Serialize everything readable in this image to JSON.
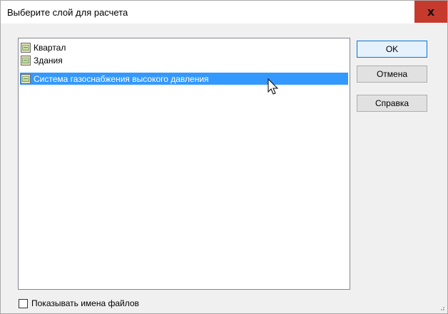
{
  "dialog": {
    "title": "Выберите слой для расчета",
    "close_symbol": "x"
  },
  "layers": [
    {
      "label": "Квартал",
      "icon": "layer-icon",
      "selected": false
    },
    {
      "label": "Здания",
      "icon": "layer-icon",
      "selected": false
    },
    {
      "label": "Система газоснабжения высокого давления",
      "icon": "layer-icon",
      "selected": true
    }
  ],
  "buttons": {
    "ok_label": "OK",
    "cancel_label": "Отмена",
    "help_label": "Справка"
  },
  "options": {
    "show_filenames_label": "Показывать имена файлов",
    "show_filenames_checked": false
  },
  "colors": {
    "selection": "#3399ff",
    "close_button": "#c63a2e",
    "default_button_border": "#0078d7"
  }
}
